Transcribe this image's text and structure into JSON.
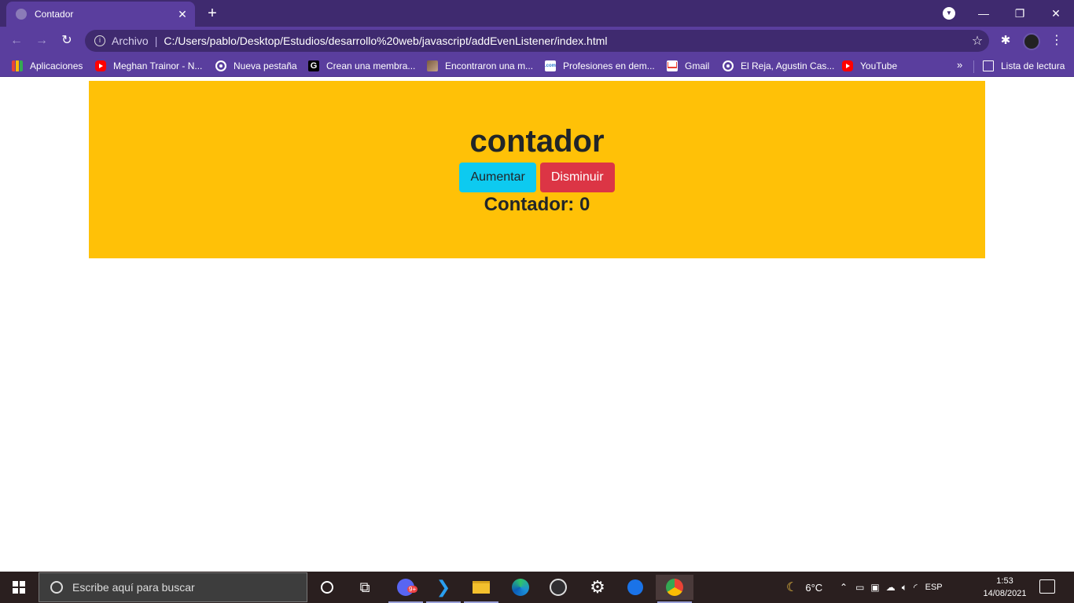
{
  "browser": {
    "tab_title": "Contador",
    "tab_close": "✕",
    "new_tab": "+",
    "url_scheme_label": "Archivo",
    "url": "C:/Users/pablo/Desktop/Estudios/desarrollo%20web/javascript/addEvenListener/index.html"
  },
  "bookmarks": {
    "items": [
      {
        "label": "Aplicaciones",
        "icon": "apps-grid-icon"
      },
      {
        "label": "Meghan Trainor - N...",
        "icon": "youtube-icon"
      },
      {
        "label": "Nueva pestaña",
        "icon": "globe-icon"
      },
      {
        "label": "Crean una membra...",
        "icon": "g-icon"
      },
      {
        "label": "Encontraron una m...",
        "icon": "image-icon"
      },
      {
        "label": "Profesiones en dem...",
        "icon": "dotcom-icon"
      },
      {
        "label": "Gmail",
        "icon": "gmail-icon"
      },
      {
        "label": "El Reja, Agustin Cas...",
        "icon": "globe-icon"
      },
      {
        "label": "YouTube",
        "icon": "youtube-icon"
      }
    ],
    "more": "»",
    "reading_list": "Lista de lectura"
  },
  "page": {
    "heading": "contador",
    "increase_label": "Aumentar",
    "decrease_label": "Disminuir",
    "counter_text": "Contador: 0"
  },
  "taskbar": {
    "search_placeholder": "Escribe aquí para buscar",
    "temperature": "6°C",
    "language": "ESP",
    "time": "1:53",
    "date": "14/08/2021",
    "discord_badge": "9+"
  },
  "colors": {
    "hero_bg": "#ffc107",
    "info_button": "#0dcaf0",
    "danger_button": "#dc3545",
    "browser_frame": "#5a3e9e"
  }
}
